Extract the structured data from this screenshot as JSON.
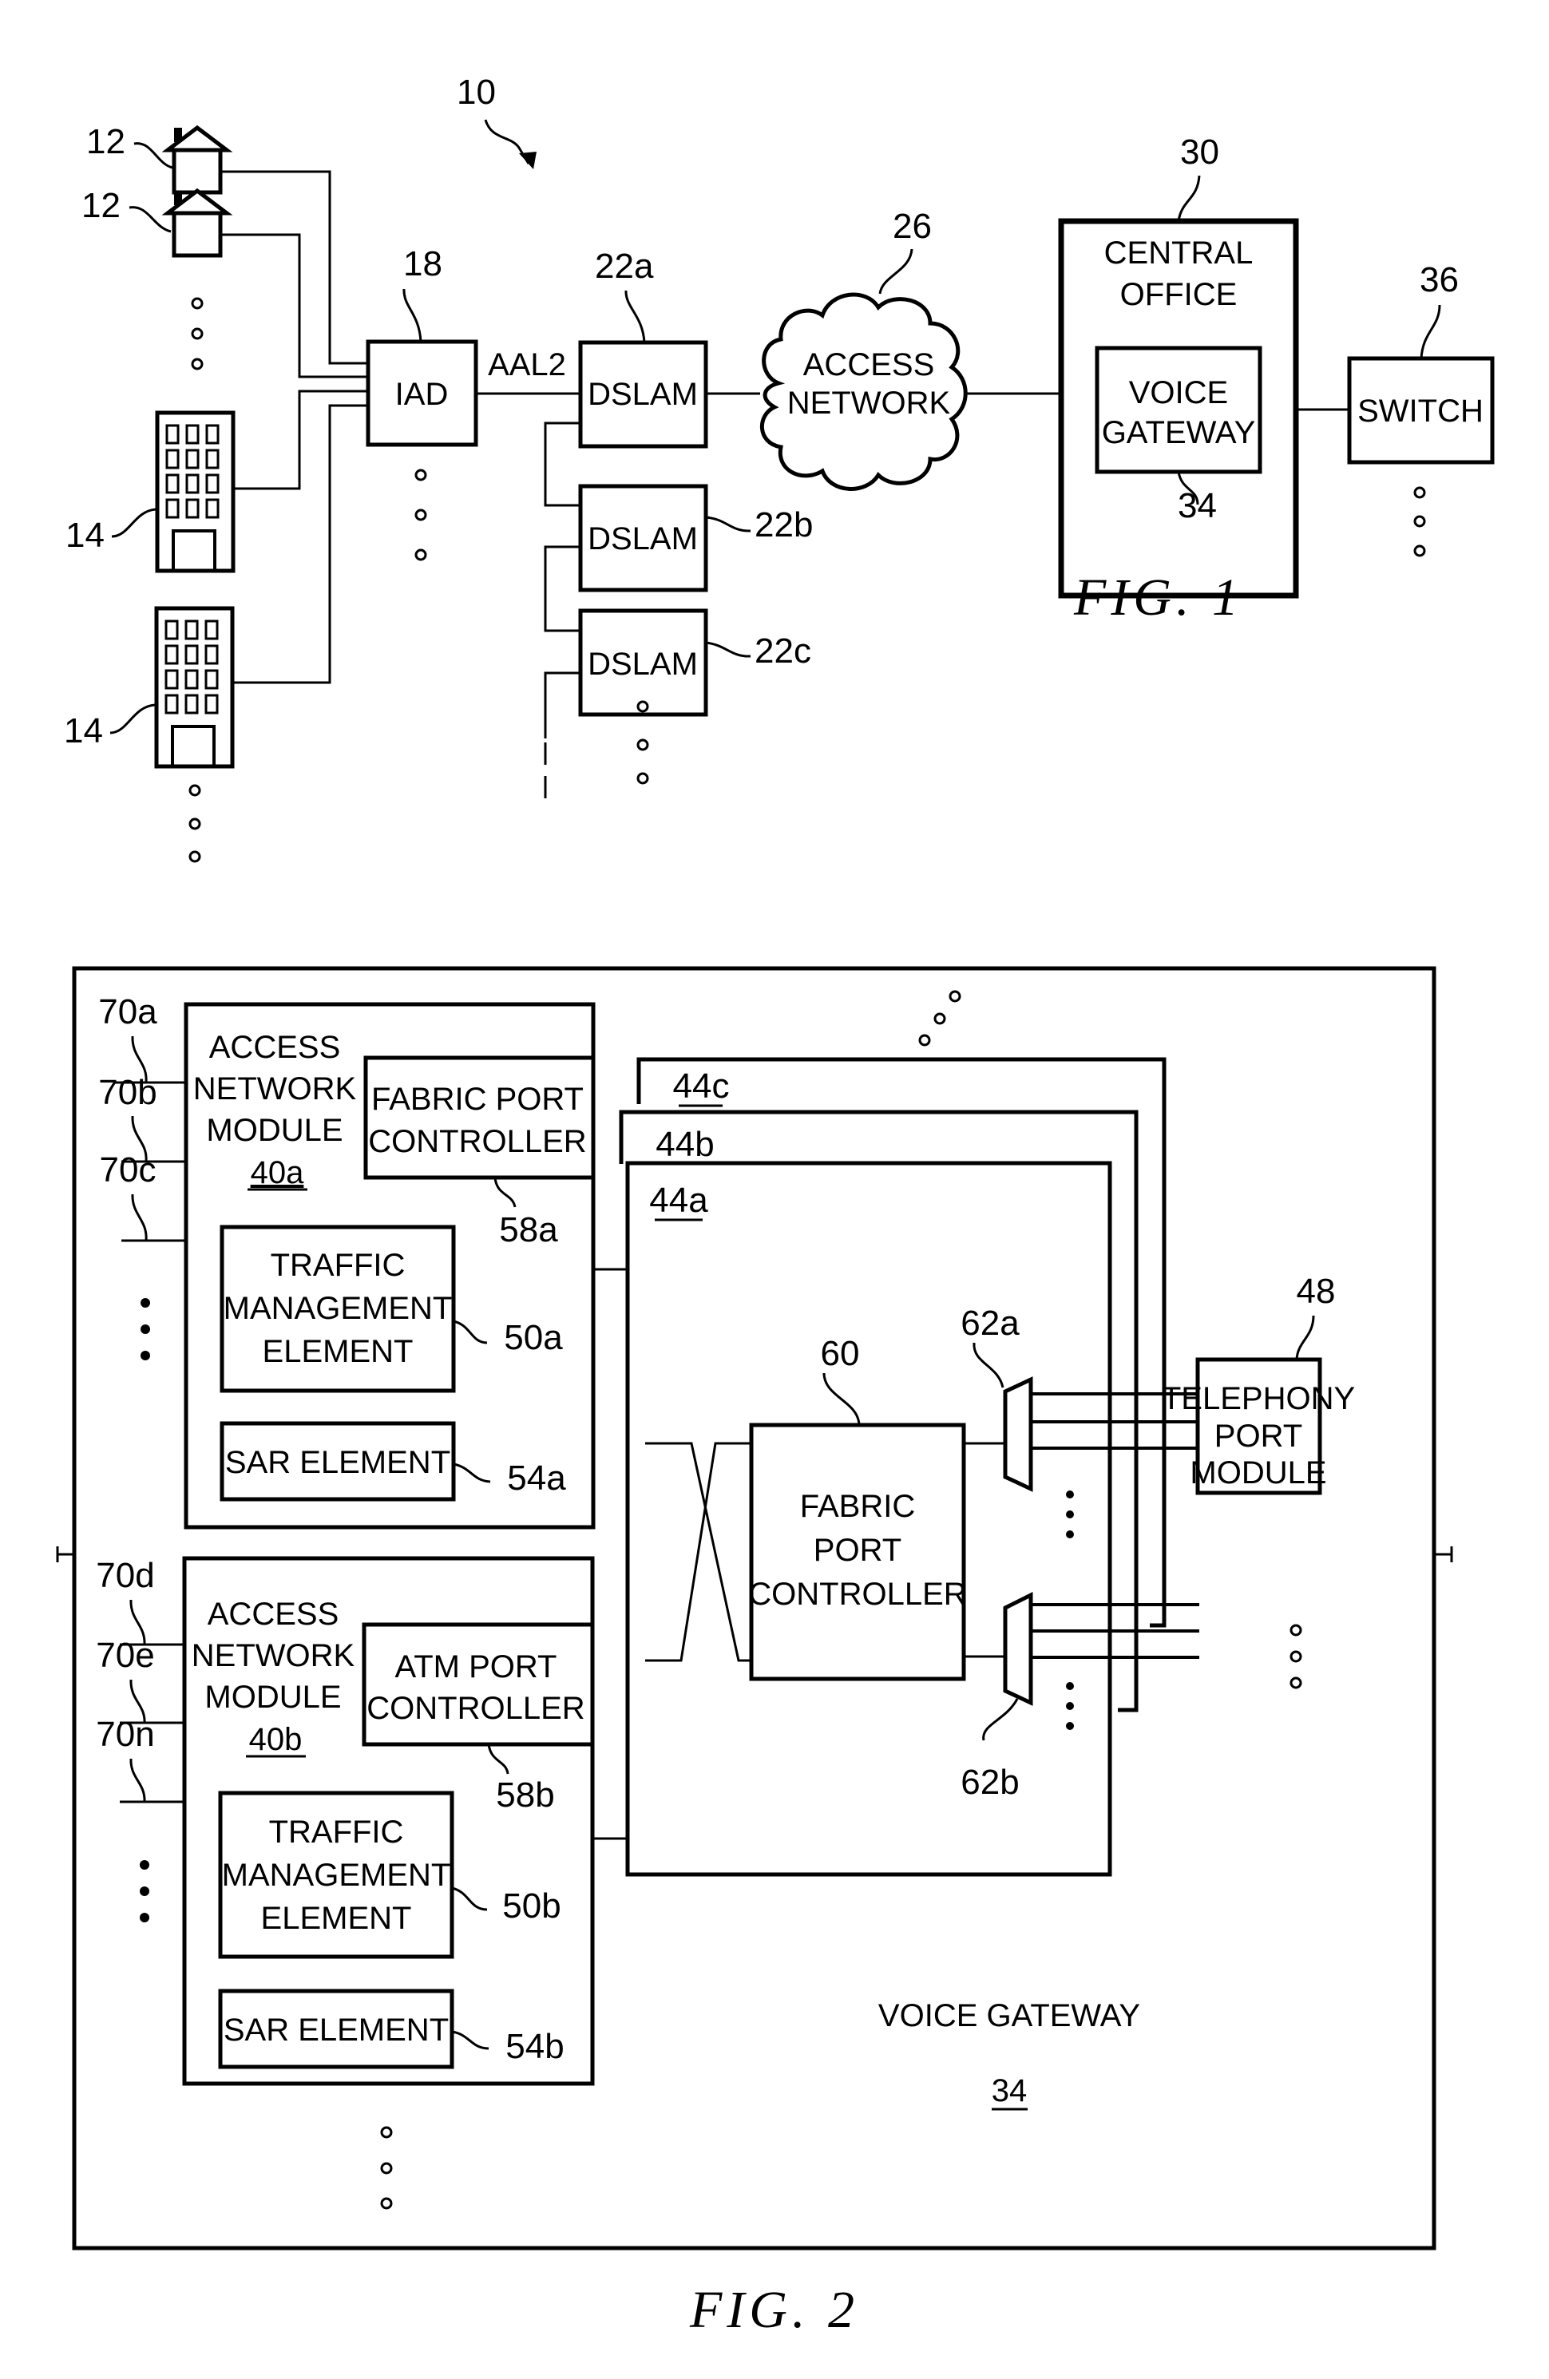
{
  "fig1": {
    "caption": "FIG. 1",
    "system_ref": "10",
    "house_ref_1": "12",
    "house_ref_2": "12",
    "building_ref_1": "14",
    "building_ref_2": "14",
    "iad": {
      "label": "IAD",
      "ref": "18"
    },
    "link_label": "AAL2",
    "dslams": [
      {
        "label": "DSLAM",
        "ref": "22a"
      },
      {
        "label": "DSLAM",
        "ref": "22b"
      },
      {
        "label": "DSLAM",
        "ref": "22c"
      }
    ],
    "access_network": {
      "line1": "ACCESS",
      "line2": "NETWORK",
      "ref": "26"
    },
    "central_office": {
      "line1": "CENTRAL",
      "line2": "OFFICE",
      "ref": "30"
    },
    "voice_gateway": {
      "line1": "VOICE",
      "line2": "GATEWAY",
      "ref": "34"
    },
    "switch": {
      "label": "SWITCH",
      "ref": "36"
    }
  },
  "fig2": {
    "caption": "FIG. 2",
    "gateway_title": "VOICE GATEWAY",
    "gateway_ref": "34",
    "modules": [
      {
        "line1": "ACCESS",
        "line2": "NETWORK",
        "line3": "MODULE",
        "ref": "40a",
        "port_ctrl_line1": "FABRIC PORT",
        "port_ctrl_line2": "CONTROLLER",
        "port_ctrl_ref": "58a",
        "tm_line1": "TRAFFIC",
        "tm_line2": "MANAGEMENT",
        "tm_line3": "ELEMENT",
        "tm_ref": "50a",
        "sar_label": "SAR ELEMENT",
        "sar_ref": "54a",
        "port_refs": [
          "70a",
          "70b",
          "70c"
        ]
      },
      {
        "line1": "ACCESS",
        "line2": "NETWORK",
        "line3": "MODULE",
        "ref": "40b",
        "port_ctrl_line1": "ATM PORT",
        "port_ctrl_line2": "CONTROLLER",
        "port_ctrl_ref": "58b",
        "tm_line1": "TRAFFIC",
        "tm_line2": "MANAGEMENT",
        "tm_line3": "ELEMENT",
        "tm_ref": "50b",
        "sar_label": "SAR ELEMENT",
        "sar_ref": "54b",
        "port_refs": [
          "70d",
          "70e",
          "70n"
        ]
      }
    ],
    "switch_cards": [
      "44a",
      "44b",
      "44c"
    ],
    "fabric_port_controller": {
      "line1": "FABRIC",
      "line2": "PORT",
      "line3": "CONTROLLER",
      "ref": "60"
    },
    "mux_refs": [
      "62a",
      "62b"
    ],
    "telephony_port_module": {
      "line1": "TELEPHONY",
      "line2": "PORT",
      "line3": "MODULE",
      "ref": "48"
    }
  }
}
